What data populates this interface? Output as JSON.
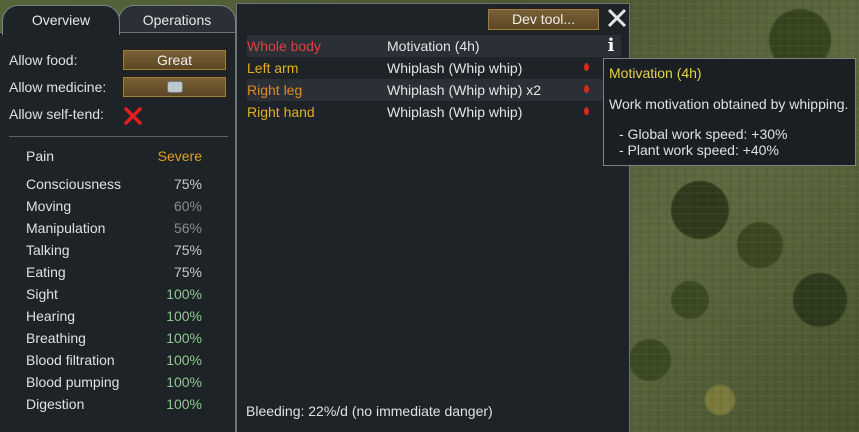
{
  "tabs": [
    {
      "label": "Overview",
      "active": true
    },
    {
      "label": "Operations",
      "active": false
    }
  ],
  "settings": {
    "allow_food_label": "Allow food:",
    "allow_food_value": "Great",
    "allow_medicine_label": "Allow medicine:",
    "allow_medicine_icon": "medicine-icon",
    "allow_self_tend_label": "Allow self-tend:",
    "allow_self_tend_icon": "red-cross-icon"
  },
  "pain": {
    "label": "Pain",
    "value": "Severe",
    "color": "#e0a020"
  },
  "capacities": [
    {
      "name": "Consciousness",
      "value": "75%",
      "color": "#c8c8c8"
    },
    {
      "name": "Moving",
      "value": "60%",
      "color": "#8c8c8c"
    },
    {
      "name": "Manipulation",
      "value": "56%",
      "color": "#8c8c8c"
    },
    {
      "name": "Talking",
      "value": "75%",
      "color": "#c8c8c8"
    },
    {
      "name": "Eating",
      "value": "75%",
      "color": "#c8c8c8"
    },
    {
      "name": "Sight",
      "value": "100%",
      "color": "#8fc98f"
    },
    {
      "name": "Hearing",
      "value": "100%",
      "color": "#8fc98f"
    },
    {
      "name": "Breathing",
      "value": "100%",
      "color": "#8fc98f"
    },
    {
      "name": "Blood filtration",
      "value": "100%",
      "color": "#8fc98f"
    },
    {
      "name": "Blood pumping",
      "value": "100%",
      "color": "#8fc98f"
    },
    {
      "name": "Digestion",
      "value": "100%",
      "color": "#8fc98f"
    }
  ],
  "dev_tool_label": "Dev tool...",
  "hediffs": [
    {
      "part": "Whole body",
      "desc": "Motivation (4h)",
      "part_color": "#e04040",
      "icon": "info-icon"
    },
    {
      "part": "Left arm",
      "desc": "Whiplash (Whip whip)",
      "part_color": "#e0b020",
      "icon": "blood-drop-icon"
    },
    {
      "part": "Right leg",
      "desc": "Whiplash (Whip whip) x2",
      "part_color": "#e08a20",
      "icon": "blood-drop-icon"
    },
    {
      "part": "Right hand",
      "desc": "Whiplash (Whip whip)",
      "part_color": "#e0b020",
      "icon": "blood-drop-icon"
    }
  ],
  "bleeding": "Bleeding: 22%/d (no immediate danger)",
  "tooltip": {
    "title": "Motivation (4h)",
    "description": "Work motivation obtained by whipping.",
    "lines": [
      "- Global work speed: +30%",
      "- Plant work speed: +40%"
    ]
  }
}
